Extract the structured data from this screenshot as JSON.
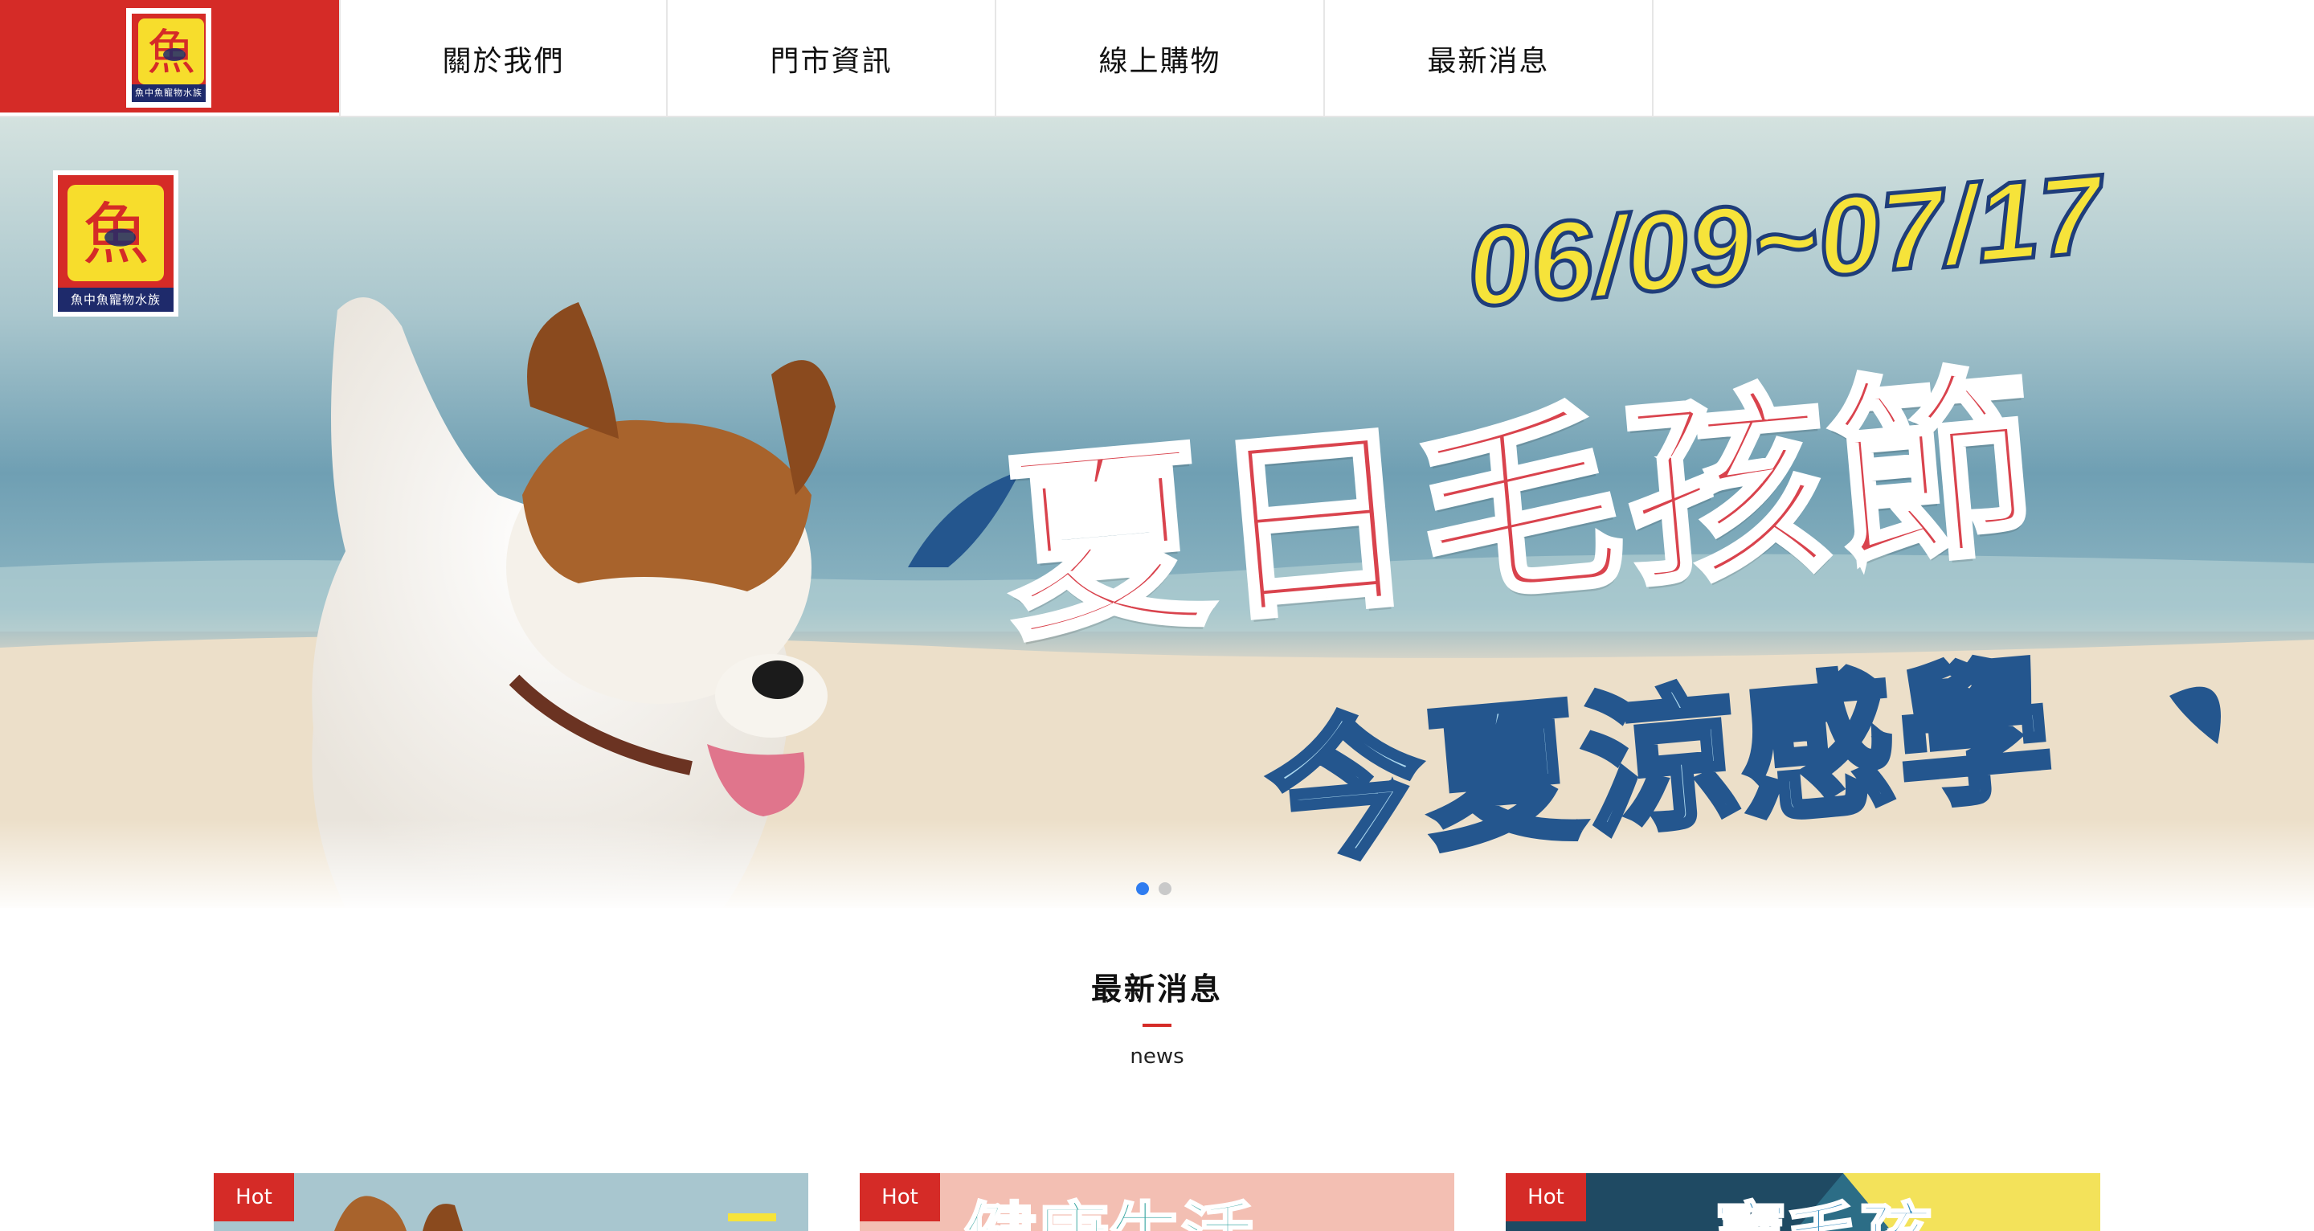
{
  "brand": {
    "logo_char": "魚",
    "logo_caption": "魚中魚寵物水族",
    "primary_color": "#d52b27",
    "logo_yellow": "#f7dd2c"
  },
  "nav": {
    "items": [
      {
        "label": "關於我們"
      },
      {
        "label": "門市資訊"
      },
      {
        "label": "線上購物"
      },
      {
        "label": "最新消息"
      }
    ]
  },
  "hero": {
    "date_range": "06/09~07/17",
    "title": "夏日毛孩節",
    "subtitle": "今夏涼感學",
    "slide_count": 2,
    "active_slide": 1,
    "active_dot_color": "#2f7cf0"
  },
  "news": {
    "title": "最新消息",
    "subtitle": "news",
    "cards": [
      {
        "badge": "Hot",
        "banner_text": ""
      },
      {
        "badge": "Hot",
        "banner_text": "健康生活"
      },
      {
        "badge": "Hot",
        "banner_text": "寶毛孩"
      }
    ]
  }
}
